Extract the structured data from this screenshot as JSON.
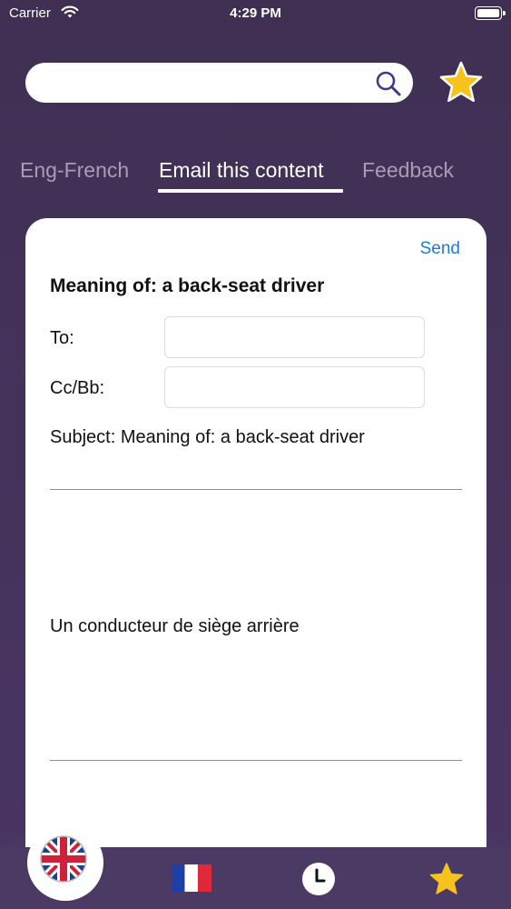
{
  "status_bar": {
    "carrier": "Carrier",
    "time": "4:29 PM",
    "wifi_icon": "wifi-icon",
    "battery_icon": "battery-icon"
  },
  "search": {
    "value": "",
    "placeholder": "",
    "icon": "search-icon"
  },
  "favorites_button": {
    "icon": "star-icon",
    "color": "#f7c21a"
  },
  "tabs": [
    {
      "label": "Eng-French",
      "active": false
    },
    {
      "label": "Email this content",
      "active": true
    },
    {
      "label": "Feedback",
      "active": false
    }
  ],
  "email": {
    "send_label": "Send",
    "heading": "Meaning of: a back-seat driver",
    "to_label": "To:",
    "to_value": "",
    "cc_label": "Cc/Bb:",
    "cc_value": "",
    "subject": "Subject: Meaning of: a back-seat driver",
    "body": "Un conducteur de siège arrière"
  },
  "bottom_tabs": [
    {
      "icon": "uk-flag-icon",
      "selected": true
    },
    {
      "icon": "france-flag-icon",
      "selected": false
    },
    {
      "icon": "clock-icon",
      "selected": false
    },
    {
      "icon": "star-icon",
      "selected": false
    }
  ],
  "colors": {
    "background": "#44325a",
    "accent_link": "#1a7ce0",
    "star": "#f7c21a",
    "tab_inactive": "#a79db4"
  }
}
